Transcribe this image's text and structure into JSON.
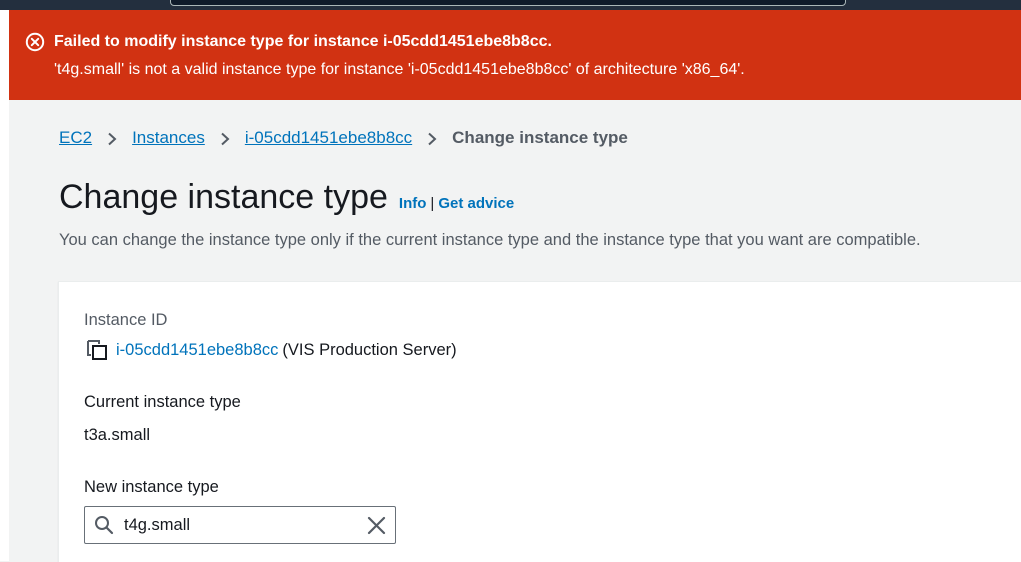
{
  "flash": {
    "type": "error",
    "title": "Failed to modify instance type for instance i-05cdd1451ebe8b8cc.",
    "message": "'t4g.small' is not a valid instance type for instance 'i-05cdd1451ebe8b8cc' of architecture 'x86_64'.",
    "icon": "error-circle-icon",
    "color": "#d13212"
  },
  "breadcrumb": {
    "items": [
      {
        "label": "EC2"
      },
      {
        "label": "Instances"
      },
      {
        "label": "i-05cdd1451ebe8b8cc"
      }
    ],
    "current": "Change instance type"
  },
  "header": {
    "title": "Change instance type",
    "info_link": "Info",
    "separator": "|",
    "advice_link": "Get advice",
    "description": "You can change the instance type only if the current instance type and the instance type that you want are compatible."
  },
  "form": {
    "instance_id_label": "Instance ID",
    "instance_id": "i-05cdd1451ebe8b8cc",
    "instance_name": "(VIS Production Server)",
    "current_type_label": "Current instance type",
    "current_type": "t3a.small",
    "new_type_label": "New instance type",
    "new_type_value": "t4g.small"
  },
  "colors": {
    "link": "#0073bb",
    "error": "#d13212",
    "nav": "#232f3e"
  }
}
